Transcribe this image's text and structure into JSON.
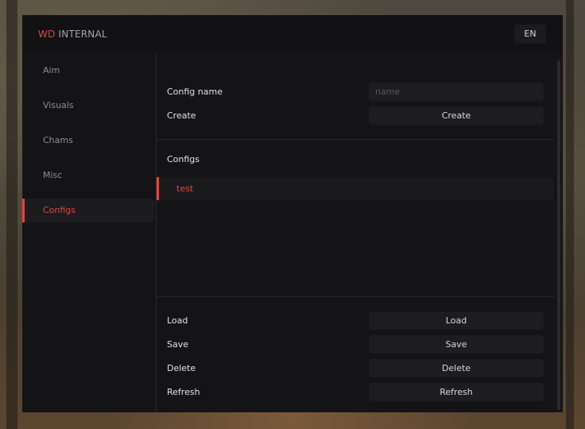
{
  "colors": {
    "accent": "#e0473f",
    "window_bg": "#141416",
    "control_bg": "#1d1d20"
  },
  "brand": {
    "prefix": "WD",
    "suffix": "INTERNAL"
  },
  "language_button": "EN",
  "sidebar": {
    "items": [
      {
        "label": "Aim",
        "active": false
      },
      {
        "label": "Visuals",
        "active": false
      },
      {
        "label": "Chams",
        "active": false
      },
      {
        "label": "Misc",
        "active": false
      },
      {
        "label": "Configs",
        "active": true
      }
    ]
  },
  "config_form": {
    "name_label": "Config name",
    "name_placeholder": "name",
    "name_value": "",
    "create_label": "Create",
    "create_button": "Create"
  },
  "configs": {
    "heading": "Configs",
    "items": [
      {
        "name": "test",
        "selected": true
      }
    ]
  },
  "actions": [
    {
      "label": "Load",
      "button": "Load"
    },
    {
      "label": "Save",
      "button": "Save"
    },
    {
      "label": "Delete",
      "button": "Delete"
    },
    {
      "label": "Refresh",
      "button": "Refresh"
    }
  ]
}
